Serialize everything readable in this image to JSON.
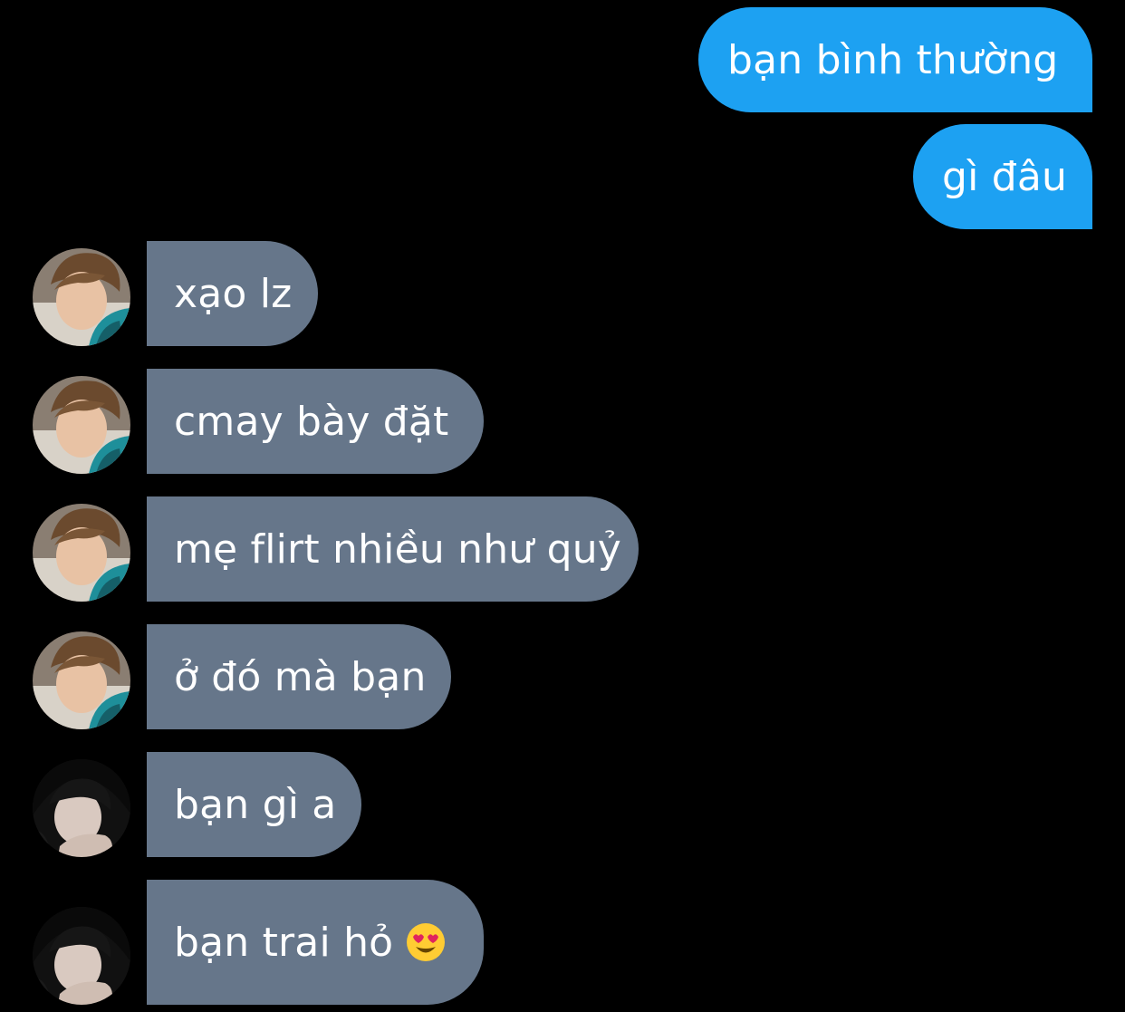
{
  "messages": {
    "outgoing": [
      {
        "text": "bạn bình thường"
      },
      {
        "text": "gì đâu"
      }
    ],
    "incoming": [
      {
        "text": "xạo lz",
        "avatar": "avatar-boy"
      },
      {
        "text": "cmay bày đặt",
        "avatar": "avatar-boy"
      },
      {
        "text": "mẹ flirt nhiều như quỷ",
        "avatar": "avatar-boy"
      },
      {
        "text": "ở đó mà bạn",
        "avatar": "avatar-boy"
      },
      {
        "text": "bạn gì a",
        "avatar": "avatar-girl"
      },
      {
        "text": "bạn trai hỏ",
        "avatar": "avatar-girl",
        "emoji": "heart-eyes-emoji"
      }
    ]
  },
  "colors": {
    "background": "#000000",
    "outgoing_bubble": "#1da1f2",
    "incoming_bubble": "#66768a",
    "text": "#ffffff"
  }
}
